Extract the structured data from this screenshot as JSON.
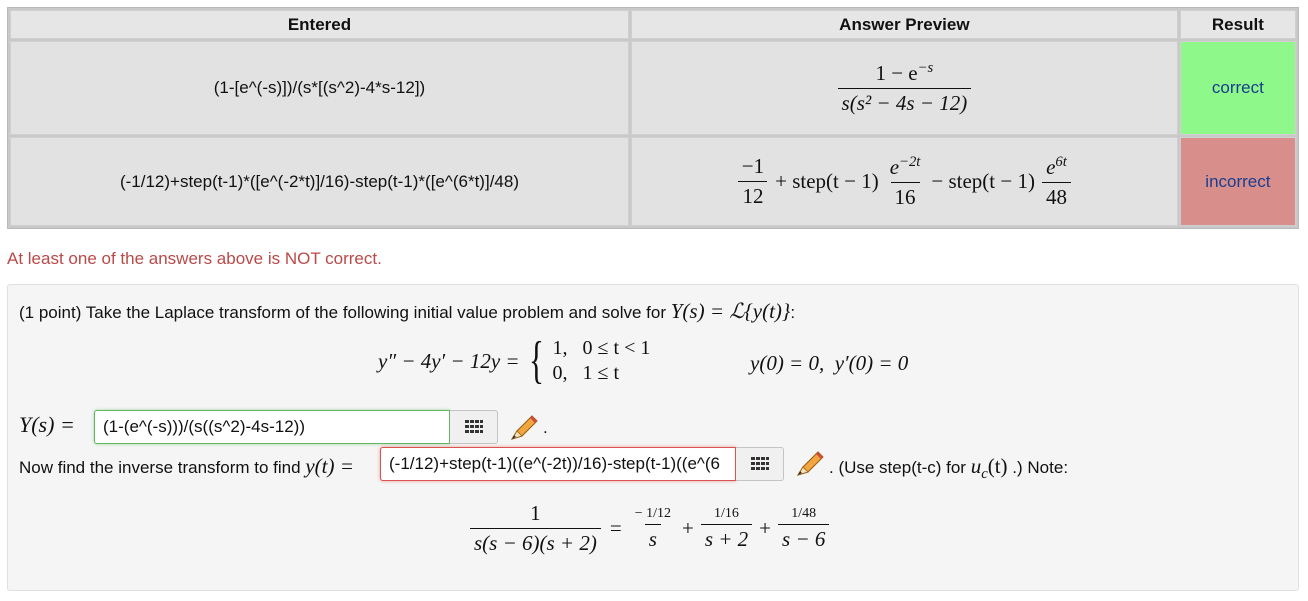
{
  "table": {
    "headers": [
      "Entered",
      "Answer Preview",
      "Result"
    ],
    "rows": [
      {
        "entered": "(1-[e^(-s)])/(s*[(s^2)-4*s-12])",
        "preview_num": "1 − e",
        "preview_num_sup": "−s",
        "preview_den": "s(s² − 4s − 12)",
        "result": "correct",
        "result_color": "#8ef98a"
      },
      {
        "entered": "(-1/12)+step(t-1)*([e^(-2*t)]/16)-step(t-1)*([e^(6*t)]/48)",
        "preview_a_num": "−1",
        "preview_a_den": "12",
        "preview_step1": "+ step(t − 1)",
        "preview_b_num": "e",
        "preview_b_sup": "−2t",
        "preview_b_den": "16",
        "preview_step2": "− step(t − 1)",
        "preview_c_num": "e",
        "preview_c_sup": "6t",
        "preview_c_den": "48",
        "result": "incorrect",
        "result_color": "#d88f8c"
      }
    ]
  },
  "warning": "At least one of the answers above is NOT correct.",
  "problem": {
    "intro": "(1 point) Take the Laplace transform of the following initial value problem and solve for",
    "intro_math": "Y(s) = ℒ{y(t)}",
    "intro_end": ":",
    "ode_lhs": "y″ − 4y′ − 12y =",
    "case1": "1,   0 ≤ t < 1",
    "case2": "0,   1 ≤ t",
    "initial_conditions": "y(0) = 0,  y′(0) = 0",
    "ys_label": "Y(s) =",
    "ys_value": "(1-(e^(-s)))/(s((s^2)-4s-12))",
    "ys_after": ".",
    "inverse_text": "Now find the inverse transform to find",
    "inverse_label": "y(t) =",
    "yt_value": "(-1/12)+step(t-1)((e^(-2t))/16)-step(t-1)((e^(6",
    "note_text_a": ". (Use step(t-c) for",
    "note_math": "u",
    "note_math_sub": "c",
    "note_math_arg": "(t)",
    "note_text_b": ".) Note:",
    "pf_lhs_num": "1",
    "pf_lhs_den": "s(s − 6)(s + 2)",
    "pf_eq": "=",
    "pf_t1_num": "− 1/12",
    "pf_t1_den": "s",
    "pf_plus": "+",
    "pf_t2_num": "1/16",
    "pf_t2_den": "s + 2",
    "pf_t3_num": "1/48",
    "pf_t3_den": "s − 6"
  },
  "icons": {
    "equation_editor": "grid-icon",
    "preview": "pencil-icon"
  }
}
